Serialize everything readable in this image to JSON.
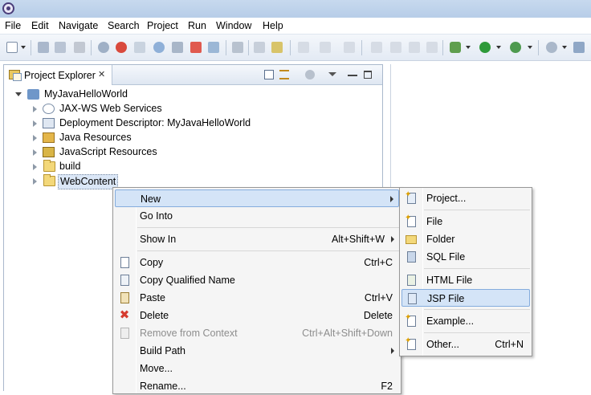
{
  "menubar": {
    "items": [
      {
        "label": "File"
      },
      {
        "label": "Edit"
      },
      {
        "label": "Navigate"
      },
      {
        "label": "Search"
      },
      {
        "label": "Project"
      },
      {
        "label": "Run"
      },
      {
        "label": "Window"
      },
      {
        "label": "Help"
      }
    ]
  },
  "view": {
    "tab_label": "Project Explorer",
    "close_glyph": "✕"
  },
  "tree": {
    "project": "MyJavaHelloWorld",
    "children": [
      {
        "label": "JAX-WS Web Services"
      },
      {
        "label": "Deployment Descriptor: MyJavaHelloWorld"
      },
      {
        "label": "Java Resources"
      },
      {
        "label": "JavaScript Resources"
      },
      {
        "label": "build"
      },
      {
        "label": "WebContent"
      }
    ]
  },
  "context_menu": {
    "items": [
      {
        "label": "New",
        "shortcut": ""
      },
      {
        "label": "Go Into",
        "shortcut": ""
      },
      {
        "label": "Show In",
        "shortcut": "Alt+Shift+W"
      },
      {
        "label": "Copy",
        "shortcut": "Ctrl+C"
      },
      {
        "label": "Copy Qualified Name",
        "shortcut": ""
      },
      {
        "label": "Paste",
        "shortcut": "Ctrl+V"
      },
      {
        "label": "Delete",
        "shortcut": "Delete"
      },
      {
        "label": "Remove from Context",
        "shortcut": "Ctrl+Alt+Shift+Down"
      },
      {
        "label": "Build Path",
        "shortcut": ""
      },
      {
        "label": "Move...",
        "shortcut": ""
      },
      {
        "label": "Rename...",
        "shortcut": "F2"
      }
    ]
  },
  "submenu": {
    "items": [
      {
        "label": "Project...",
        "shortcut": ""
      },
      {
        "label": "File",
        "shortcut": ""
      },
      {
        "label": "Folder",
        "shortcut": ""
      },
      {
        "label": "SQL File",
        "shortcut": ""
      },
      {
        "label": "HTML File",
        "shortcut": ""
      },
      {
        "label": "JSP File",
        "shortcut": ""
      },
      {
        "label": "Example...",
        "shortcut": ""
      },
      {
        "label": "Other...",
        "shortcut": "Ctrl+N"
      }
    ]
  },
  "colors": {
    "highlight_bg": "#d4e4f7",
    "highlight_border": "#84acdd",
    "delete_icon": "#d63b2f",
    "run_icon": "#2e9a3a"
  }
}
